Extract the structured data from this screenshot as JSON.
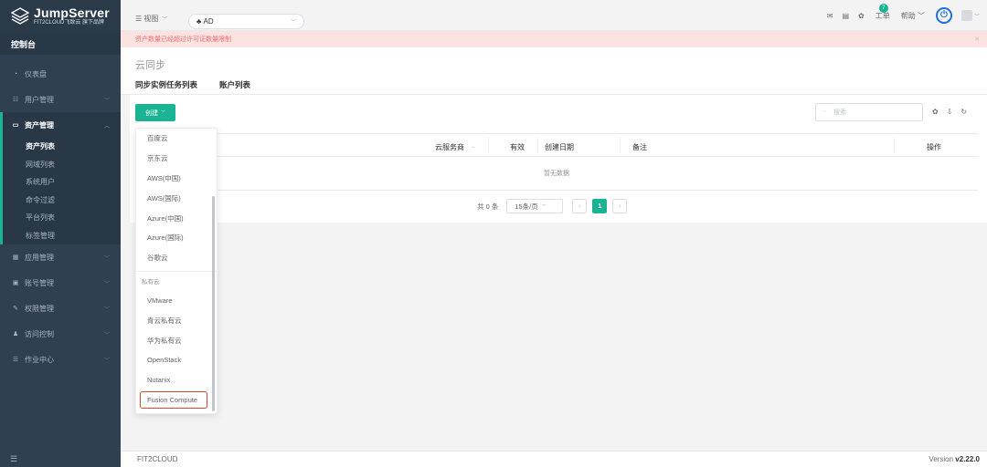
{
  "brand": {
    "name": "JumpServer",
    "tagline": "FIT2CLOUD飞致云 旗下品牌"
  },
  "sidebar": {
    "console_label": "控制台",
    "items": [
      {
        "label": "仪表盘",
        "icon": "dashboard-icon"
      },
      {
        "label": "用户管理",
        "icon": "users-icon"
      },
      {
        "label": "资产管理",
        "icon": "inbox-icon"
      },
      {
        "label": "应用管理",
        "icon": "apps-icon"
      },
      {
        "label": "账号管理",
        "icon": "id-card-icon"
      },
      {
        "label": "权限管理",
        "icon": "edit-icon"
      },
      {
        "label": "访问控制",
        "icon": "users-control-icon"
      },
      {
        "label": "作业中心",
        "icon": "list-icon"
      }
    ],
    "asset_subitems": [
      "资产列表",
      "网域列表",
      "系统用户",
      "命令过滤",
      "平台列表",
      "标签管理"
    ]
  },
  "topbar": {
    "view_label": "视图",
    "org_label": "AD",
    "tickets_label": "工单",
    "tickets_count": "7",
    "help_label": "帮助"
  },
  "alert": {
    "text": "资产数量已经超过许可证数量限制"
  },
  "page": {
    "title": "云同步",
    "tabs": [
      "同步实例任务列表",
      "账户列表"
    ]
  },
  "toolbar": {
    "create_label": "创建",
    "search_placeholder": "搜索"
  },
  "table": {
    "columns": [
      "云服务商",
      "有效",
      "创建日期",
      "备注",
      "操作"
    ],
    "empty_text": "暂无数据"
  },
  "pagination": {
    "total_text": "共 0 条",
    "page_size": "15条/页",
    "current_page": "1"
  },
  "dropdown": {
    "public_items": [
      "百度云",
      "京东云",
      "AWS(中国)",
      "AWS(国际)",
      "Azure(中国)",
      "Azure(国际)",
      "谷歌云"
    ],
    "private_group": "私有云",
    "private_items": [
      "VMware",
      "青云私有云",
      "华为私有云",
      "OpenStack",
      "Nutanix"
    ],
    "highlighted_item": "Fusion Compute"
  },
  "footer": {
    "company": "FIT2CLOUD",
    "version_prefix": "Version",
    "version": "v2.22.0"
  },
  "colors": {
    "accent": "#1ab394",
    "sidebar_bg": "#2f4050",
    "alert_bg": "#fde2e2",
    "highlight_border": "#e0452b",
    "power_blue": "#1e6fe0"
  }
}
